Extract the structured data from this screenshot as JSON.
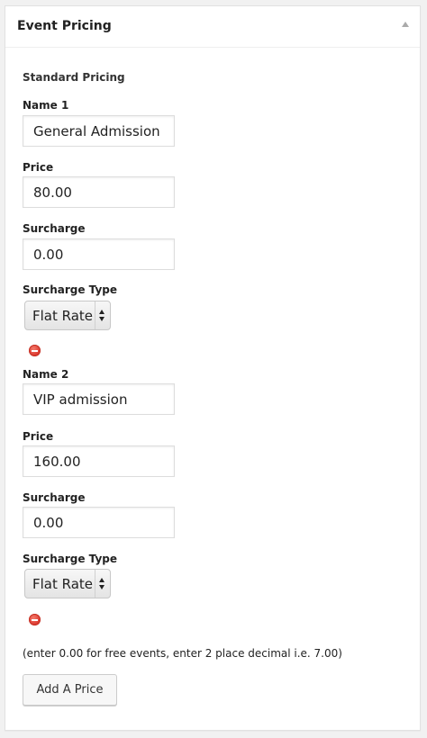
{
  "panel": {
    "title": "Event Pricing",
    "section_label": "Standard Pricing"
  },
  "prices": [
    {
      "name_label": "Name 1",
      "name_value": "General Admission",
      "price_label": "Price",
      "price_value": "80.00",
      "surcharge_label": "Surcharge",
      "surcharge_value": "0.00",
      "surcharge_type_label": "Surcharge Type",
      "surcharge_type_value": "Flat Rate"
    },
    {
      "name_label": "Name 2",
      "name_value": "VIP admission",
      "price_label": "Price",
      "price_value": "160.00",
      "surcharge_label": "Surcharge",
      "surcharge_value": "0.00",
      "surcharge_type_label": "Surcharge Type",
      "surcharge_type_value": "Flat Rate"
    }
  ],
  "help_text": "(enter 0.00 for free events, enter 2 place decimal i.e. 7.00)",
  "add_button_label": "Add A Price",
  "colors": {
    "remove_icon": "#d9332a",
    "panel_background": "#ffffff",
    "page_background": "#f1f1f1"
  },
  "icons": {
    "collapse": "triangle-up-icon",
    "remove": "remove-circle-icon",
    "select": "up-down-arrows-icon"
  }
}
